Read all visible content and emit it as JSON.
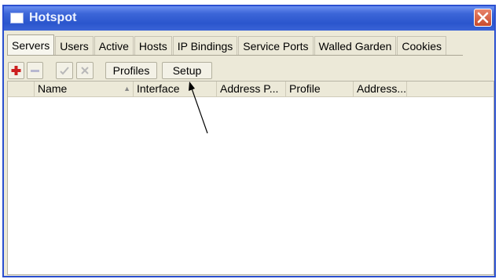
{
  "window": {
    "title": "Hotspot",
    "close_label": "close"
  },
  "tabs": [
    {
      "label": "Servers",
      "active": true
    },
    {
      "label": "Users",
      "active": false
    },
    {
      "label": "Active",
      "active": false
    },
    {
      "label": "Hosts",
      "active": false
    },
    {
      "label": "IP Bindings",
      "active": false
    },
    {
      "label": "Service Ports",
      "active": false
    },
    {
      "label": "Walled Garden",
      "active": false
    },
    {
      "label": "Cookies",
      "active": false
    }
  ],
  "toolbar": {
    "add_icon": "plus-icon",
    "remove_icon": "minus-icon",
    "enable_icon": "check-icon",
    "disable_icon": "cross-icon",
    "profiles_label": "Profiles",
    "setup_label": "Setup"
  },
  "table": {
    "columns": [
      "Name",
      "Interface",
      "Address P...",
      "Profile",
      "Address..."
    ],
    "rows": []
  },
  "colors": {
    "titlebar": "#2b56cd",
    "add_icon": "#cc1f1f",
    "window_bg": "#ece9d8"
  }
}
